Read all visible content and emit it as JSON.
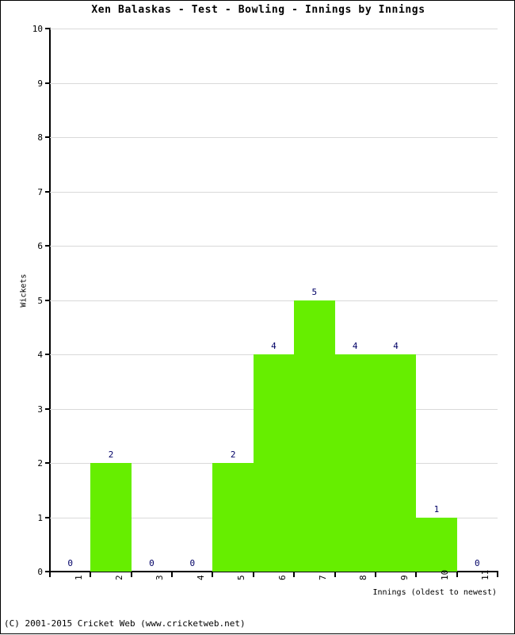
{
  "chart_data": {
    "type": "bar",
    "title": "Xen Balaskas - Test - Bowling - Innings by Innings",
    "xlabel": "Innings (oldest to newest)",
    "ylabel": "Wickets",
    "categories": [
      "1",
      "2",
      "3",
      "4",
      "5",
      "6",
      "7",
      "8",
      "9",
      "10",
      "11"
    ],
    "values": [
      0,
      2,
      0,
      0,
      2,
      4,
      5,
      4,
      4,
      1,
      0
    ],
    "point_labels": [
      "0",
      "2",
      "0",
      "0",
      "2",
      "4",
      "5",
      "4",
      "4",
      "1",
      "0"
    ],
    "ylim": [
      0,
      10
    ],
    "ytick_labels": [
      "0",
      "1",
      "2",
      "3",
      "4",
      "5",
      "6",
      "7",
      "8",
      "9",
      "10"
    ],
    "ytick_values": [
      0,
      1,
      2,
      3,
      4,
      5,
      6,
      7,
      8,
      9,
      10
    ],
    "grid": true,
    "legend": false,
    "bar_color": "#66ee00",
    "label_color": "#000066",
    "grid_color": "#d9d9d9",
    "axis_color": "#000000"
  },
  "footer": {
    "copyright": "(C) 2001-2015 Cricket Web (www.cricketweb.net)"
  }
}
